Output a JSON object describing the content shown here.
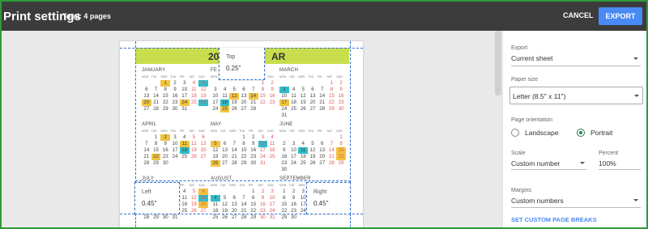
{
  "header": {
    "title": "Print settings",
    "total": "Total: 4 pages",
    "cancel_label": "CANCEL",
    "export_label": "EXPORT"
  },
  "calendar": {
    "title_left": "20",
    "title_right": "AR",
    "months": [
      {
        "name": "JANUARY",
        "dows": [
          "MON",
          "TUE",
          "WED",
          "THU",
          "FRI",
          "SAT",
          "SUN"
        ],
        "days": [
          [
            "",
            "",
            "1",
            "2",
            "3",
            "4",
            "5"
          ],
          [
            "6",
            "7",
            "8",
            "9",
            "10",
            "11",
            "12"
          ],
          [
            "13",
            "14",
            "15",
            "16",
            "17",
            "18",
            "19"
          ],
          [
            "20",
            "21",
            "22",
            "23",
            "24",
            "25",
            "26"
          ],
          [
            "27",
            "28",
            "29",
            "30",
            "31",
            "",
            ""
          ]
        ],
        "highlight_yellow": [
          "1",
          "20",
          "24"
        ],
        "highlight_teal": [
          "5",
          "26"
        ]
      },
      {
        "name": "FE",
        "dows": [
          "MON",
          "TUE",
          "WED",
          "THU",
          "FRI",
          "SAT",
          "SUN"
        ],
        "days": [
          [
            "",
            "",
            "",
            "",
            "",
            "1",
            "2"
          ],
          [
            "3",
            "4",
            "5",
            "6",
            "7",
            "8",
            "9"
          ],
          [
            "10",
            "11",
            "12",
            "13",
            "14",
            "15",
            "16"
          ],
          [
            "17",
            "18",
            "19",
            "20",
            "21",
            "22",
            "23"
          ],
          [
            "24",
            "25",
            "26",
            "27",
            "28",
            "",
            ""
          ]
        ],
        "highlight_yellow": [
          "12",
          "14",
          "25"
        ],
        "highlight_teal": [
          "18"
        ]
      },
      {
        "name": "MARCH",
        "dows": [
          "MON",
          "TUE",
          "WED",
          "THU",
          "FRI",
          "SAT",
          "SUN"
        ],
        "days": [
          [
            "",
            "",
            "",
            "",
            "",
            "1",
            "2"
          ],
          [
            "3",
            "4",
            "5",
            "6",
            "7",
            "8",
            "9"
          ],
          [
            "10",
            "11",
            "12",
            "13",
            "14",
            "15",
            "16"
          ],
          [
            "17",
            "18",
            "19",
            "20",
            "21",
            "22",
            "23"
          ],
          [
            "24",
            "25",
            "26",
            "27",
            "28",
            "29",
            "30"
          ],
          [
            "31",
            "",
            "",
            "",
            "",
            "",
            ""
          ]
        ],
        "highlight_yellow": [
          "17"
        ],
        "highlight_teal": [
          "3"
        ]
      },
      {
        "name": "APRIL",
        "dows": [
          "MON",
          "TUE",
          "WED",
          "THU",
          "FRI",
          "SAT",
          "SUN"
        ],
        "days": [
          [
            "",
            "1",
            "2",
            "3",
            "4",
            "5",
            "6"
          ],
          [
            "7",
            "8",
            "9",
            "10",
            "11",
            "12",
            "13"
          ],
          [
            "14",
            "15",
            "16",
            "17",
            "18",
            "19",
            "20"
          ],
          [
            "21",
            "22",
            "23",
            "24",
            "25",
            "26",
            "27"
          ],
          [
            "28",
            "29",
            "30",
            "",
            "",
            "",
            ""
          ]
        ],
        "highlight_yellow": [
          "2",
          "11",
          "22"
        ],
        "highlight_teal": [
          "18"
        ]
      },
      {
        "name": "MAY",
        "dows": [
          "MON",
          "TUE",
          "WED",
          "THU",
          "FRI",
          "SAT",
          "SUN"
        ],
        "days": [
          [
            "",
            "",
            "",
            "1",
            "2",
            "3",
            "4"
          ],
          [
            "5",
            "6",
            "7",
            "8",
            "9",
            "10",
            "11"
          ],
          [
            "12",
            "13",
            "14",
            "15",
            "16",
            "17",
            "18"
          ],
          [
            "19",
            "20",
            "21",
            "22",
            "23",
            "24",
            "25"
          ],
          [
            "26",
            "27",
            "28",
            "29",
            "30",
            "31",
            ""
          ]
        ],
        "highlight_yellow": [
          "5",
          "26"
        ],
        "highlight_teal": [
          "10"
        ]
      },
      {
        "name": "JUNE",
        "dows": [
          "MON",
          "TUE",
          "WED",
          "THU",
          "FRI",
          "SAT",
          "SUN"
        ],
        "days": [
          [
            "",
            "",
            "",
            "",
            "",
            "",
            "1"
          ],
          [
            "2",
            "3",
            "4",
            "5",
            "6",
            "7",
            "8"
          ],
          [
            "9",
            "10",
            "11",
            "12",
            "13",
            "14",
            "15"
          ],
          [
            "16",
            "17",
            "18",
            "19",
            "20",
            "21",
            "22"
          ],
          [
            "23",
            "24",
            "25",
            "26",
            "27",
            "28",
            "29"
          ],
          [
            "30",
            "",
            "",
            "",
            "",
            "",
            ""
          ]
        ],
        "highlight_yellow": [
          "15",
          "22"
        ],
        "highlight_teal": [
          "11"
        ]
      },
      {
        "name": "JULY",
        "dows": [
          "MON",
          "TUE",
          "WED",
          "THU",
          "FRI",
          "SAT",
          "SUN"
        ],
        "days": [
          [
            "",
            "1",
            "2",
            "3",
            "4",
            "5",
            "6"
          ],
          [
            "7",
            "8",
            "9",
            "10",
            "11",
            "12",
            "13"
          ],
          [
            "14",
            "15",
            "16",
            "17",
            "18",
            "19",
            "20"
          ],
          [
            "21",
            "22",
            "23",
            "24",
            "25",
            "26",
            "27"
          ],
          [
            "28",
            "29",
            "30",
            "31",
            "",
            "",
            ""
          ]
        ],
        "highlight_yellow": [
          "6",
          "20"
        ],
        "highlight_teal": [
          "13"
        ]
      },
      {
        "name": "AUGUST",
        "dows": [
          "MON",
          "TUE",
          "WED",
          "THU",
          "FRI",
          "SAT",
          "SUN"
        ],
        "days": [
          [
            "",
            "",
            "",
            "",
            "1",
            "2",
            "3"
          ],
          [
            "4",
            "5",
            "6",
            "7",
            "8",
            "9",
            "10"
          ],
          [
            "11",
            "12",
            "13",
            "14",
            "15",
            "16",
            "17"
          ],
          [
            "18",
            "19",
            "20",
            "21",
            "22",
            "23",
            "24"
          ],
          [
            "25",
            "26",
            "27",
            "28",
            "29",
            "30",
            "31"
          ]
        ],
        "highlight_yellow": [],
        "highlight_teal": [
          "4"
        ]
      },
      {
        "name": "SEPTEMBER",
        "dows": [
          "MON",
          "TUE",
          "WED",
          "THU",
          "FRI",
          "SAT",
          "SUN"
        ],
        "days": [
          [
            "1",
            "2",
            "3",
            "4",
            "5",
            "6",
            "7"
          ],
          [
            "8",
            "9",
            "10",
            "11",
            "12",
            "13",
            "14"
          ],
          [
            "15",
            "16",
            "17",
            "18",
            "19",
            "20",
            "21"
          ],
          [
            "22",
            "23",
            "24",
            "25",
            "26",
            "27",
            "28"
          ],
          [
            "29",
            "30",
            "",
            "",
            "",
            "",
            ""
          ]
        ],
        "highlight_yellow": [
          "7",
          "14"
        ],
        "highlight_teal": []
      }
    ]
  },
  "margins_overlay": {
    "top": {
      "label": "Top",
      "value": "0.25\""
    },
    "left": {
      "label": "Left",
      "value": "0.45\""
    },
    "right": {
      "label": "Right",
      "value": "0.45\""
    }
  },
  "settings": {
    "export": {
      "label": "Export",
      "value": "Current sheet"
    },
    "paper_size": {
      "label": "Paper size",
      "value": "Letter (8.5\" x 11\")"
    },
    "orientation": {
      "label": "Page orientation",
      "options": [
        "Landscape",
        "Portrait"
      ],
      "selected": "Portrait"
    },
    "scale": {
      "label": "Scale",
      "value": "Custom number"
    },
    "percent": {
      "label": "Percent",
      "value": "100%"
    },
    "margins": {
      "label": "Margins",
      "value": "Custom numbers"
    },
    "page_breaks_link": "SET CUSTOM PAGE BREAKS"
  },
  "colors": {
    "accent": "#4a8af4",
    "topbar": "#3c3c3c",
    "cal_header": "#c9de4c",
    "yellow": "#f2c33e",
    "teal": "#2fbcc9",
    "radio": "#2c7d57"
  }
}
